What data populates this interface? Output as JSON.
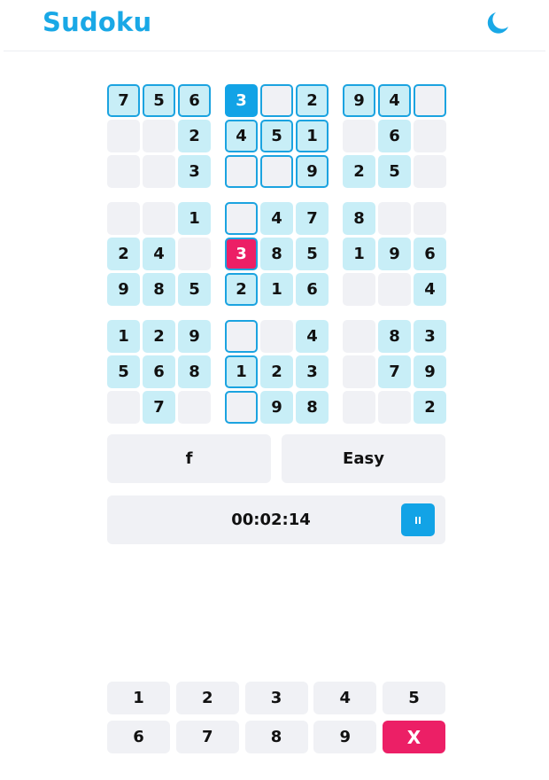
{
  "header": {
    "title": "Sudoku",
    "theme_icon": "moon-icon"
  },
  "board": {
    "cells": [
      [
        "7",
        "5",
        "6",
        "3",
        "",
        "2",
        "9",
        "4",
        ""
      ],
      [
        "",
        "",
        "2",
        "4",
        "5",
        "1",
        "",
        "6",
        ""
      ],
      [
        "",
        "",
        "3",
        "",
        "",
        "9",
        "2",
        "5",
        ""
      ],
      [
        "",
        "",
        "1",
        "",
        "4",
        "7",
        "8",
        "",
        ""
      ],
      [
        "2",
        "4",
        "",
        "3",
        "8",
        "5",
        "1",
        "9",
        "6"
      ],
      [
        "9",
        "8",
        "5",
        "2",
        "1",
        "6",
        "",
        "",
        "4"
      ],
      [
        "1",
        "2",
        "9",
        "",
        "",
        "4",
        "",
        "8",
        "3"
      ],
      [
        "5",
        "6",
        "8",
        "1",
        "2",
        "3",
        "",
        "7",
        "9"
      ],
      [
        "",
        "7",
        "",
        "",
        "9",
        "8",
        "",
        "",
        "2"
      ]
    ],
    "selected": [
      0,
      3
    ],
    "error_cells": [
      [
        4,
        3
      ]
    ],
    "highlighted_cells": [
      [
        0,
        0
      ],
      [
        0,
        1
      ],
      [
        0,
        2
      ],
      [
        0,
        4
      ],
      [
        0,
        5
      ],
      [
        0,
        6
      ],
      [
        0,
        7
      ],
      [
        0,
        8
      ],
      [
        1,
        3
      ],
      [
        1,
        4
      ],
      [
        1,
        5
      ],
      [
        2,
        3
      ],
      [
        2,
        4
      ],
      [
        2,
        5
      ],
      [
        3,
        3
      ],
      [
        4,
        3
      ],
      [
        5,
        3
      ],
      [
        6,
        3
      ],
      [
        7,
        3
      ],
      [
        8,
        3
      ]
    ]
  },
  "settings": {
    "mode_label": "f",
    "difficulty_label": "Easy"
  },
  "timer": {
    "time": "00:02:14",
    "pause_icon": "pause-icon"
  },
  "numpad": {
    "keys": [
      "1",
      "2",
      "3",
      "4",
      "5",
      "6",
      "7",
      "8",
      "9",
      "X"
    ],
    "erase_icon": "close-icon"
  },
  "colors": {
    "accent": "#12a3e6",
    "given": "#c8eef7",
    "empty": "#f0f1f5",
    "error": "#ec1f66",
    "text": "#111111"
  }
}
